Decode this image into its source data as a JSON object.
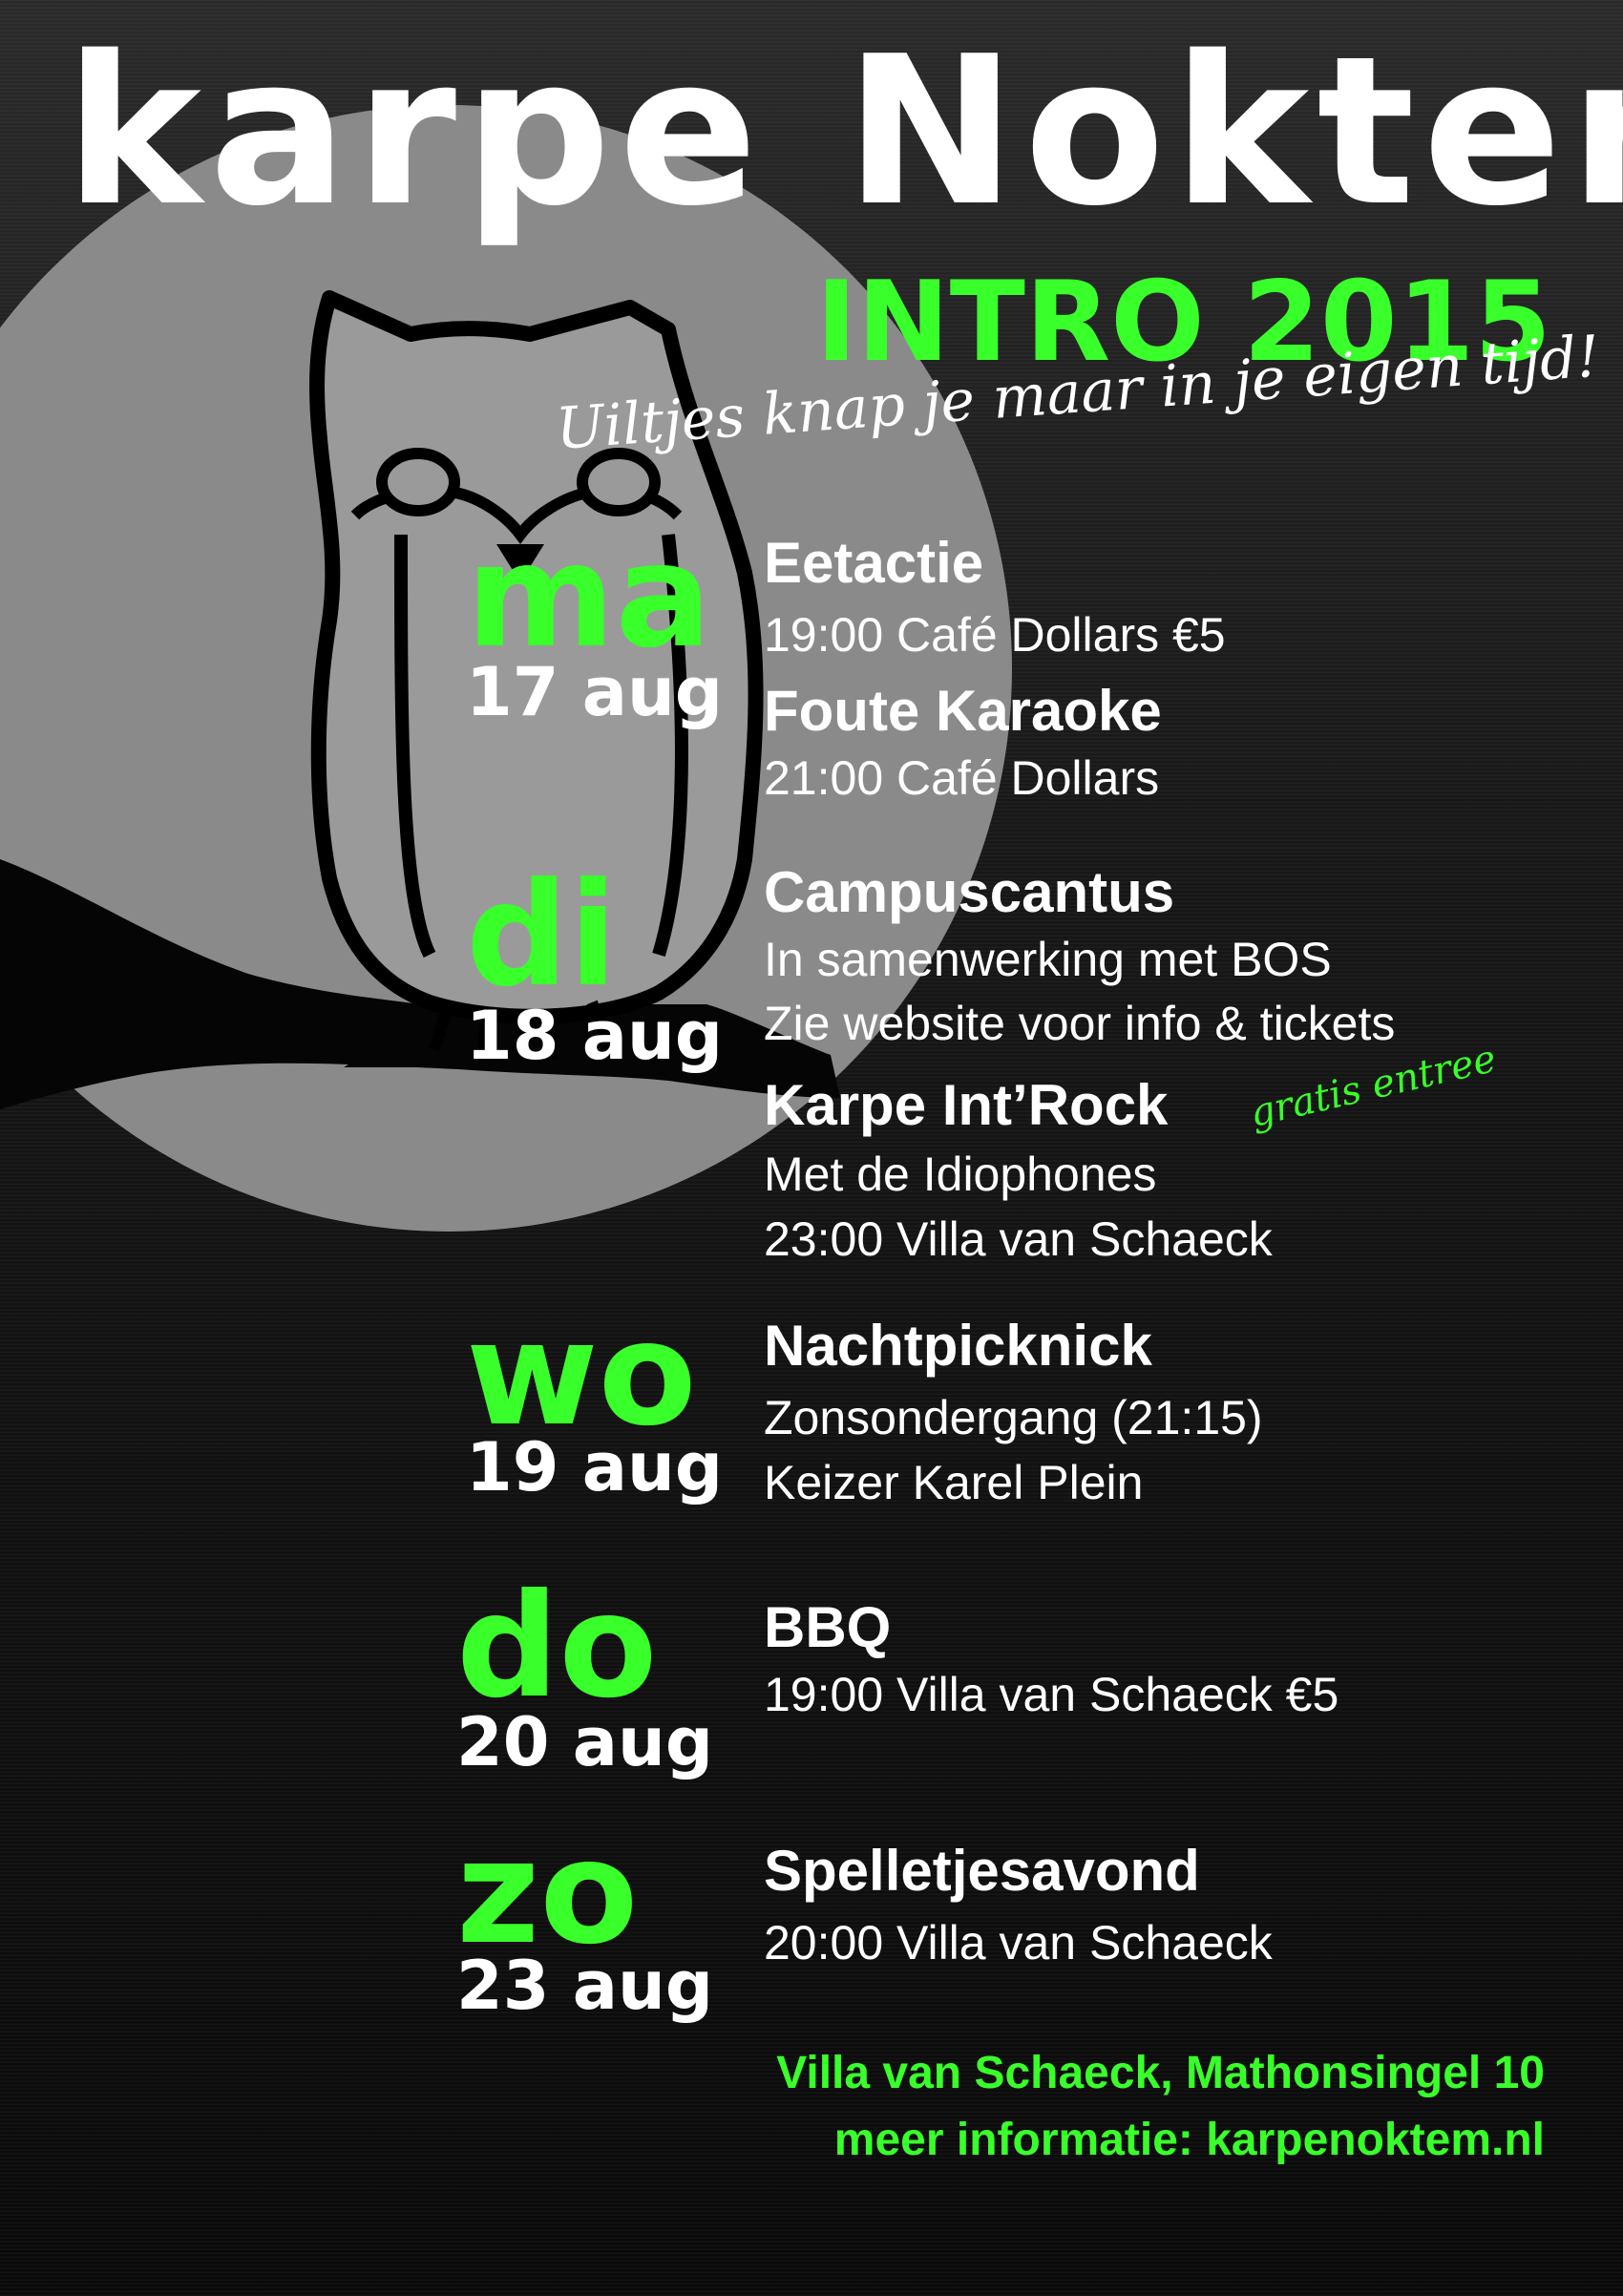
{
  "header": {
    "title": "karpe Noktem",
    "subtitle": "INTRO 2015",
    "slogan": "Uiltjes knap je maar in je eigen tijd!"
  },
  "colors": {
    "accent": "#39ff2a",
    "moon": "#8a8a8a",
    "owl_outline": "#000000",
    "text": "#ffffff"
  },
  "icons": [
    "moon-icon",
    "owl-icon",
    "branch-icon"
  ],
  "schedule": [
    {
      "day": "ma",
      "date": "17 aug",
      "events": [
        {
          "title": "Eetactie",
          "lines": [
            "19:00 Café Dollars €5"
          ]
        },
        {
          "title": "Foute Karaoke",
          "lines": [
            "21:00 Café Dollars"
          ]
        }
      ]
    },
    {
      "day": "di",
      "date": "18 aug",
      "events": [
        {
          "title": "Campuscantus",
          "lines": [
            "In samenwerking met BOS",
            "Zie website voor info & tickets"
          ]
        },
        {
          "title": "Karpe Int’Rock",
          "lines": [
            "Met de Idiophones",
            "23:00 Villa van Schaeck"
          ],
          "note": "gratis entree"
        }
      ]
    },
    {
      "day": "wo",
      "date": "19 aug",
      "events": [
        {
          "title": "Nachtpicknick",
          "lines": [
            "Zonsondergang (21:15)",
            "Keizer Karel Plein"
          ]
        }
      ]
    },
    {
      "day": "do",
      "date": "20 aug",
      "events": [
        {
          "title": "BBQ",
          "lines": [
            "19:00 Villa van Schaeck €5"
          ]
        }
      ]
    },
    {
      "day": "zo",
      "date": "23 aug",
      "events": [
        {
          "title": "Spelletjesavond",
          "lines": [
            "20:00 Villa van Schaeck"
          ]
        }
      ]
    }
  ],
  "footer": {
    "address": "Villa van Schaeck, Mathonsingel 10",
    "info": "meer informatie: karpenoktem.nl"
  }
}
